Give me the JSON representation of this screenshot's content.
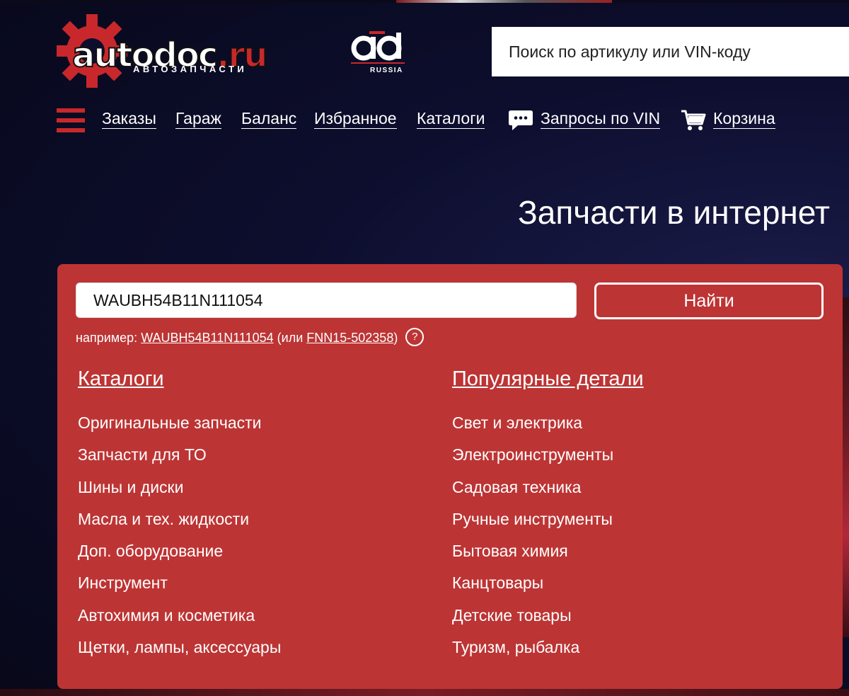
{
  "logo": {
    "brand": "autodoc",
    "domain": ".ru",
    "tagline": "АВТОЗАПЧАСТИ"
  },
  "ad_logo": {
    "region": "RUSSIA"
  },
  "top_search": {
    "placeholder": "Поиск по артикулу или VIN-коду"
  },
  "nav": {
    "items": [
      {
        "label": "Заказы"
      },
      {
        "label": "Гараж"
      },
      {
        "label": "Баланс"
      },
      {
        "label": "Избранное"
      },
      {
        "label": "Каталоги"
      },
      {
        "label": "Запросы по VIN"
      },
      {
        "label": "Корзина"
      }
    ]
  },
  "headline": "Запчасти в интернет",
  "search_panel": {
    "vin_value": "WAUBH54B11N111054",
    "find_label": "Найти",
    "example_prefix": "например:",
    "example_vin": "WAUBH54B11N111054",
    "example_or_open": "(или",
    "example_article": "FNN15-502358",
    "example_or_close": ")",
    "help_symbol": "?"
  },
  "catalogs": {
    "title": "Каталоги",
    "items": [
      "Оригинальные запчасти",
      "Запчасти для ТО",
      "Шины и диски",
      "Масла и тех. жидкости",
      "Доп. оборудование",
      "Инструмент",
      "Автохимия и косметика",
      "Щетки, лампы, аксессуары"
    ]
  },
  "popular": {
    "title": "Популярные детали",
    "items": [
      "Свет и электрика",
      "Электроинструменты",
      "Садовая техника",
      "Ручные инструменты",
      "Бытовая химия",
      "Канцтовары",
      "Детские товары",
      "Туризм, рыбалка"
    ]
  },
  "colors": {
    "brand_red": "#c8282b",
    "panel_red": "#bd3434",
    "background": "#0d0e2e"
  }
}
